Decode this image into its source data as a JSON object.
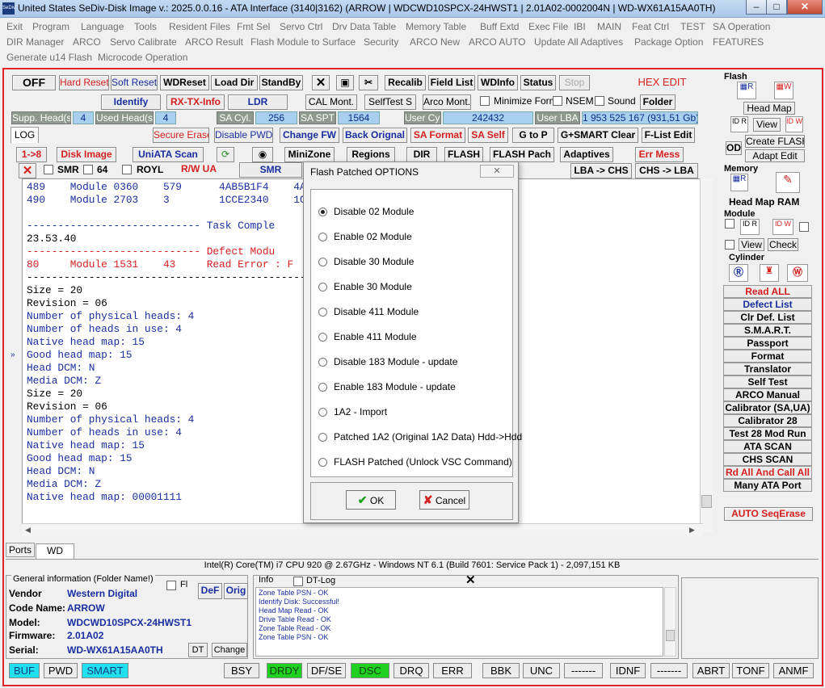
{
  "window": {
    "title": "United States  SeDiv-Disk Image v.: 2025.0.0.16 - ATA Interface (3140|3162)  (ARROW | WDCWD10SPCX-24HWST1 | 2.01A02-0002004N | WD-WX61A15AA0TH)",
    "icon_text": "SeDiv",
    "minimize": "–",
    "maximize": "□",
    "close": "✕"
  },
  "menu": {
    "row1": [
      "Exit",
      "Program",
      "Language",
      "Tools",
      "Resident Files",
      "Fmt Sel",
      "Servo Ctrl",
      "Drv Data Table",
      "Memory Table",
      "Buff Extd",
      "Exec File",
      "IBI",
      "MAIN",
      "Feat Ctrl",
      "TEST",
      "SA Operation"
    ],
    "row2": [
      "DIR Manager",
      "ARCO",
      "Servo Calibrate",
      "ARCO Result",
      "Flash Module to Surface",
      "Security",
      "ARCO New",
      "ARCO AUTO",
      "Update All Adaptives",
      "Package Option",
      "FEATURES"
    ],
    "row3": [
      "Generate u14 Flash",
      "Microcode Operation"
    ]
  },
  "toolbar1": {
    "off": "OFF",
    "hard_reset": "Hard Reset",
    "soft_reset": "Soft Reset",
    "wdreset": "WDReset",
    "load_dir": "Load Dir",
    "standby": "StandBy",
    "recalib": "Recalib",
    "field_list": "Field List",
    "wdinfo": "WDInfo",
    "status": "Status",
    "stop": "Stop",
    "hex_edit": "HEX EDIT"
  },
  "toolbar2": {
    "identify": "Identify",
    "rx_tx": "RX-TX-Info",
    "ldr": "LDR",
    "cal_mont": "CAL Mont.",
    "selftest": "SelfTest S",
    "arco_mont": "Arco Mont.",
    "minimize_form": "Minimize Form",
    "nsem": "NSEM",
    "sound": "Sound",
    "folder": "Folder"
  },
  "toolbar3": {
    "supp_heads_label": "Supp. Head(s)",
    "supp_heads": "4",
    "used_heads_label": "Used Head(s)",
    "used_heads": "4",
    "sa_cyl_label": "SA Cyl.",
    "sa_cyl": "256",
    "sa_spt_label": "SA SPT",
    "sa_spt": "1564",
    "user_cyl_label": "User Cyl.",
    "user_cyl": "242432",
    "user_lba_label": "User LBA",
    "user_lba": "1 953 525 167  (931,51 Gb)"
  },
  "toolbar4": {
    "log": "LOG",
    "secure_erase": "Secure Erase",
    "disable_pwd": "Disable PWD",
    "change_fw": "Change FW",
    "back_orignal": "Back Orignal",
    "sa_format": "SA Format",
    "sa_self": "SA Self",
    "g_to_p": "G to P",
    "g_smart_clear": "G+SMART Clear",
    "f_list_edit": "F-List Edit"
  },
  "toolbar5": {
    "one_to_eight": "1->8",
    "disk_image": "Disk Image",
    "uniata_scan": "UniATA Scan",
    "minizone": "MiniZone",
    "regions": "Regions",
    "dir": "DIR",
    "flash": "FLASH",
    "flash_pach": "FLASH Pach",
    "adaptives": "Adaptives",
    "err_mess": "Err Mess"
  },
  "toolbar6": {
    "smr": "SMR",
    "n64": "64",
    "royl": "ROYL",
    "rw_ua": "R/W UA",
    "smr2": "SMR",
    "lba_chs": "LBA -> CHS",
    "chs_lba": "CHS -> LBA"
  },
  "console": [
    {
      "t": "489    Module 0360    579      4AB5B1F4    4A",
      "c": "cb"
    },
    {
      "t": "490    Module 2703    3        1CCE2340    1C",
      "c": "cb"
    },
    {
      "t": "",
      "c": "ck"
    },
    {
      "t": "---------------------------- Task Comple",
      "c": "cb"
    },
    {
      "t": "23.53.40",
      "c": "ck"
    },
    {
      "t": "---------------------------- Defect Modu",
      "c": "cr"
    },
    {
      "t": "80     Module 1531    43     Read Error : F",
      "c": "cr"
    },
    {
      "t": "----------------------------------------------",
      "c": "ck"
    },
    {
      "t": "Size = 20",
      "c": "ck"
    },
    {
      "t": "Revision = 06",
      "c": "ck"
    },
    {
      "t": "Number of physical heads: 4",
      "c": "cb"
    },
    {
      "t": "Number of heads in use: 4",
      "c": "cb"
    },
    {
      "t": "Native head map: 15",
      "c": "cb"
    },
    {
      "t": "Good head map: 15",
      "c": "cb"
    },
    {
      "t": "Head DCM: N",
      "c": "cb"
    },
    {
      "t": "Media DCM: Z",
      "c": "cb"
    },
    {
      "t": "Size = 20",
      "c": "ck"
    },
    {
      "t": "Revision = 06",
      "c": "ck"
    },
    {
      "t": "Number of physical heads: 4",
      "c": "cb"
    },
    {
      "t": "Number of heads in use: 4",
      "c": "cb"
    },
    {
      "t": "Native head map: 15",
      "c": "cb"
    },
    {
      "t": "Good head map: 15",
      "c": "cb"
    },
    {
      "t": "Head DCM: N",
      "c": "cb"
    },
    {
      "t": "Media DCM: Z",
      "c": "cb"
    },
    {
      "t": "Native head map: 00001111",
      "c": "cb"
    }
  ],
  "dialog": {
    "title": "Flash Patched OPTIONS",
    "close": "✕",
    "options": [
      "Disable 02 Module",
      "Enable 02 Module",
      "Disable 30 Module",
      "Enable 30 Module",
      "Disable 411 Module",
      "Enable 411 Module",
      "Disable 183 Module - update",
      "Enable 183 Module - update",
      "1A2 - Import",
      "Patched 1A2 (Original 1A2 Data)  Hdd->Hdd",
      "FLASH Patched (Unlock VSC Command)"
    ],
    "selected": 0,
    "ok": "OK",
    "cancel": "Cancel"
  },
  "right_panel": {
    "flash": "Flash",
    "head_map": "Head Map",
    "view": "View",
    "create_flash": "Create FLASH",
    "adapt_edit": "Adapt Edit",
    "od": "OD",
    "memory": "Memory",
    "head_map_ram": "Head Map RAM",
    "module": "Module",
    "view2": "View",
    "check": "Check",
    "cylinder": "Cylinder",
    "buttons": [
      "Read ALL",
      "Defect List",
      "Clr Def. List",
      "S.M.A.R.T.",
      "Passport",
      "Format",
      "Translator",
      "Self Test",
      "ARCO Manual",
      "Calibrator (SA,UA)",
      "Calibrator 28",
      "Test 28 Mod Run",
      "ATA SCAN",
      "CHS SCAN",
      "Rd All And Call All",
      "Many ATA Port"
    ],
    "auto_seqerase": "AUTO SeqErase"
  },
  "tabs": {
    "ports": "Ports",
    "wd": "WD"
  },
  "cpu_info": "Intel(R) Core(TM) i7 CPU 920  @ 2.67GHz - Windows NT 6.1 (Build 7601: Service Pack 1) - 2,097,151 KB",
  "general": {
    "title": "General information (Folder Name!)",
    "fl": "Fl",
    "vendor_label": "Vendor",
    "vendor": "Western Digital",
    "code_label": "Code Name:",
    "code": "ARROW",
    "model_label": "Model:",
    "model": "WDCWD10SPCX-24HWST1",
    "fw_label": "Firmware:",
    "fw": "2.01A02",
    "serial_label": "Serial:",
    "serial": "WD-WX61A15AA0TH",
    "def": "DeF",
    "orig": "Orig",
    "dt": "DT",
    "change": "Change"
  },
  "info": {
    "title": "Info",
    "dtlog": "DT-Log",
    "lines": [
      "Zone Table PSN - OK",
      "Identify Disk: Successful!",
      "Head Map Read - OK",
      "Drive Table Read - OK",
      "Zone Table Read - OK",
      "Zone Table PSN - OK"
    ]
  },
  "status": [
    "BUF",
    "PWD",
    "SMART",
    "BSY",
    "DRDY",
    "DF/SE",
    "DSC",
    "DRQ",
    "ERR",
    "BBK",
    "UNC",
    "-------",
    "IDNF",
    "-------",
    "ABRT",
    "TONF",
    "ANMF"
  ],
  "colors": {
    "accent_red": "#e1242a",
    "blue_text": "#1a2ea0",
    "status_cyan": "#20e0f0",
    "status_green": "#20d020"
  }
}
